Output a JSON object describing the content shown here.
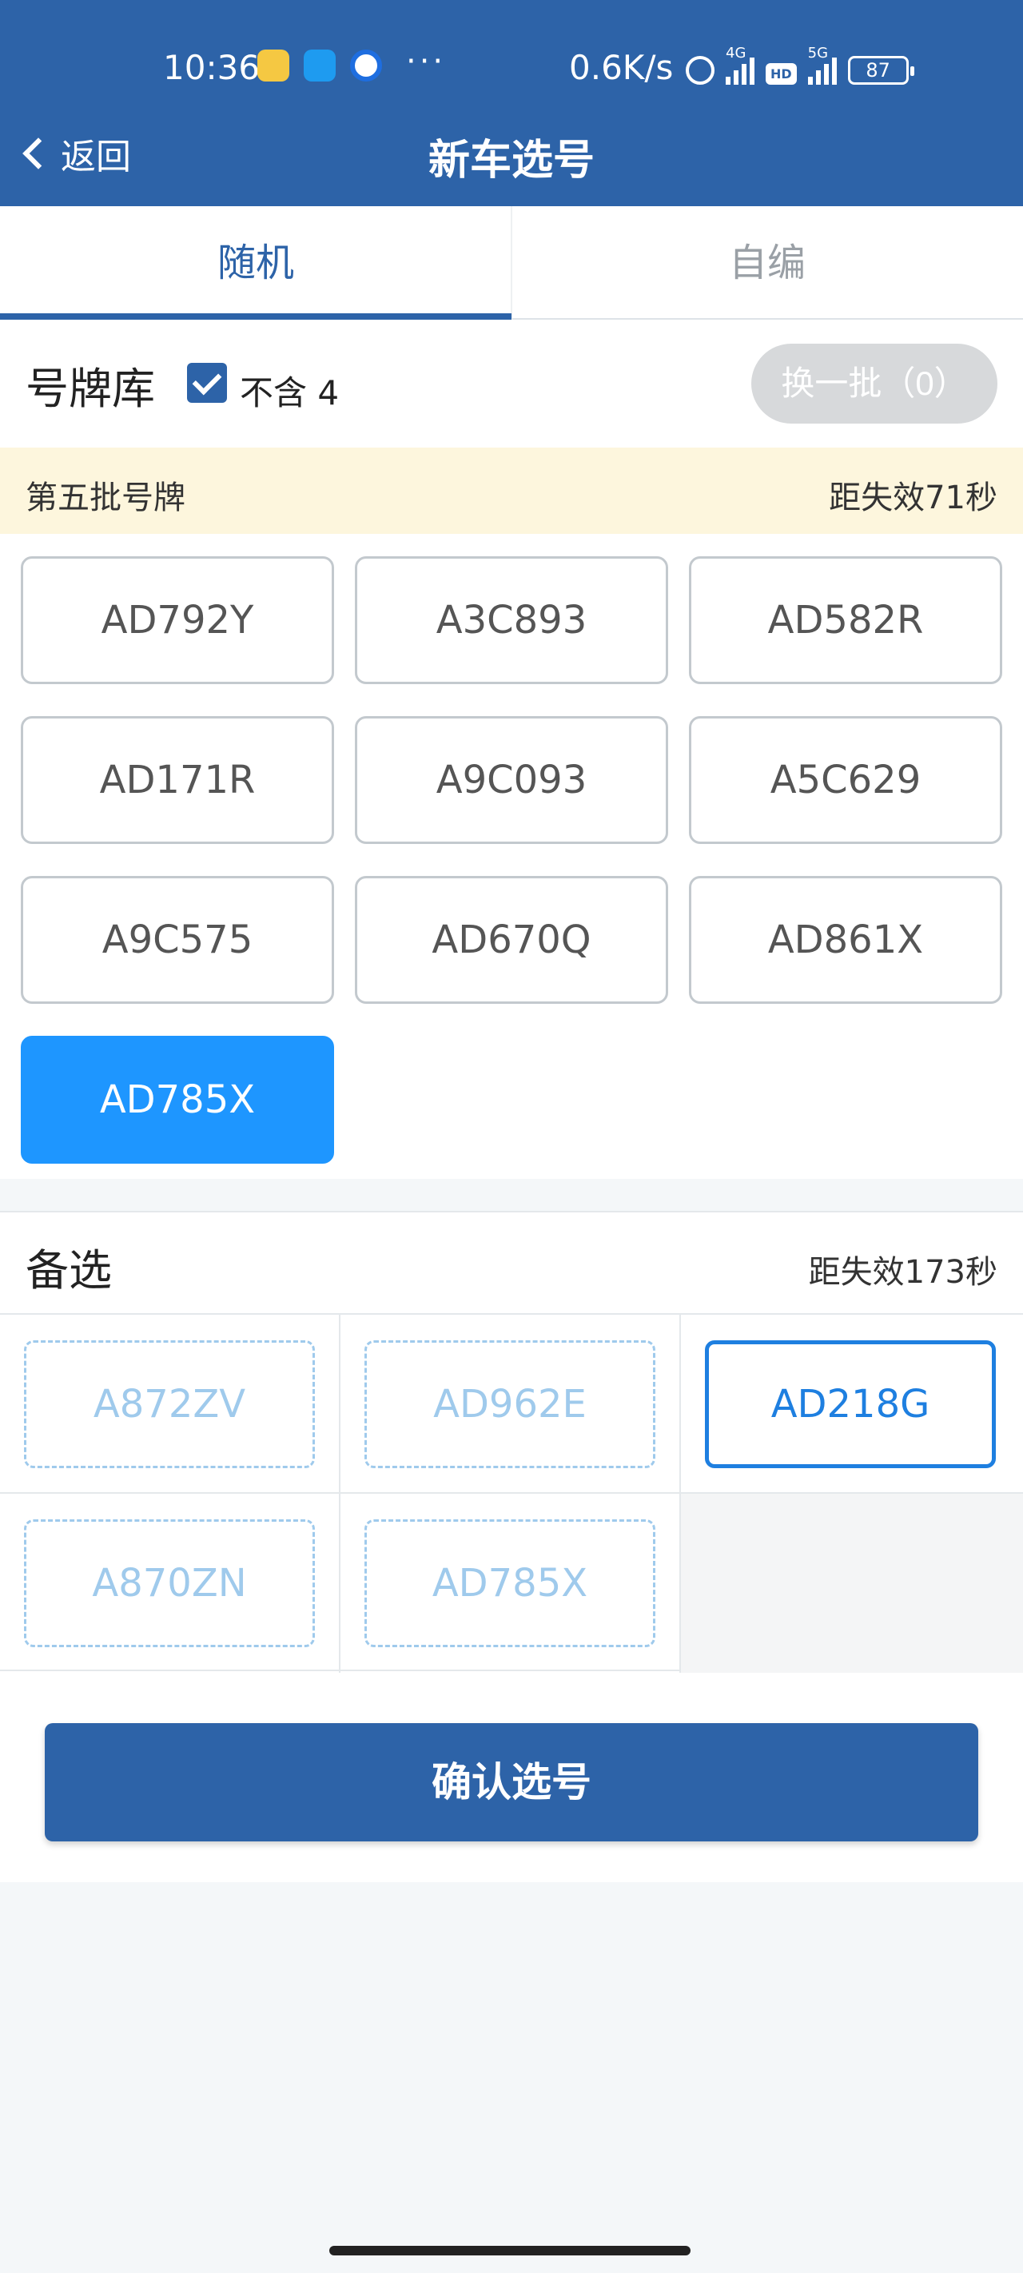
{
  "status_bar": {
    "time": "10:36",
    "dots": "···",
    "net_speed": "0.6K/s",
    "net1": "4G",
    "hd": "HD",
    "net2": "5G",
    "battery": "87"
  },
  "nav": {
    "back_label": "返回",
    "title": "新车选号"
  },
  "tabs": {
    "random": "随机",
    "custom": "自编"
  },
  "plate_library": {
    "title": "号牌库",
    "exclude_four_label": "不含 4",
    "exclude_four_checked": true,
    "refresh_label": "换一批（0）",
    "batch_name": "第五批号牌",
    "batch_expire": "距失效71秒",
    "plates": [
      "AD792Y",
      "A3C893",
      "AD582R",
      "AD171R",
      "A9C093",
      "A5C629",
      "A9C575",
      "AD670Q",
      "AD861X",
      "AD785X"
    ],
    "selected_index": 9
  },
  "alternatives": {
    "title": "备选",
    "expire": "距失效173秒",
    "plates": [
      "A872ZV",
      "AD962E",
      "AD218G",
      "A870ZN",
      "AD785X"
    ],
    "chosen_index": 2
  },
  "confirm_label": "确认选号"
}
